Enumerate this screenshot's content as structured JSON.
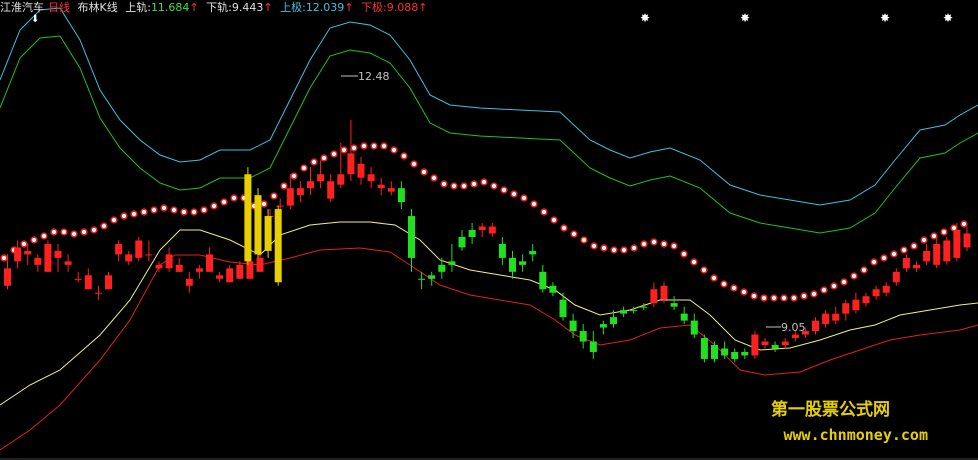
{
  "header": {
    "stock_name": "江淮汽车",
    "period": "日线",
    "indicator": "布林K线",
    "upper_label": "上轨:",
    "upper_value": "11.684",
    "lower_label": "下轨:",
    "lower_value": "9.443",
    "top_label": "上极:",
    "top_value": "12.039",
    "bottom_label": "下极:",
    "bottom_value": "9.088",
    "arrow": "↑"
  },
  "annotations": {
    "high_label": "12.48",
    "low_label": "9.05"
  },
  "watermark": {
    "line1": "第一股票公式网",
    "line2": "www.chnmoney.com"
  },
  "colors": {
    "up": "#ff2020",
    "down": "#20e020",
    "yellow": "#e8d000",
    "cyan": "#40c0e0",
    "green_band": "#20c020",
    "light_yellow": "#f0f080",
    "red_band": "#e02020"
  },
  "chart_data": {
    "type": "candlestick",
    "title": "布林K线",
    "ylim": [
      7.6,
      14.2
    ],
    "candles": [
      [
        0,
        10.35,
        10.55,
        10.05,
        10.1,
        "r"
      ],
      [
        1,
        10.45,
        10.75,
        10.35,
        10.65,
        "r"
      ],
      [
        2,
        10.55,
        10.7,
        10.4,
        10.6,
        "r"
      ],
      [
        3,
        10.4,
        10.55,
        10.3,
        10.5,
        "r"
      ],
      [
        4,
        10.7,
        10.75,
        10.3,
        10.3,
        "r"
      ],
      [
        5,
        10.6,
        10.7,
        10.3,
        10.5,
        "r"
      ],
      [
        6,
        10.45,
        10.55,
        10.3,
        10.4,
        "r"
      ],
      [
        7,
        10.2,
        10.3,
        10.15,
        10.2,
        "r"
      ],
      [
        8,
        10.25,
        10.35,
        10.05,
        10.05,
        "r"
      ],
      [
        9,
        10.0,
        10.1,
        9.9,
        10.0,
        "r"
      ],
      [
        10,
        10.25,
        10.3,
        10.05,
        10.05,
        "r"
      ],
      [
        11,
        10.55,
        10.75,
        10.45,
        10.7,
        "r"
      ],
      [
        12,
        10.45,
        10.6,
        10.4,
        10.55,
        "r"
      ],
      [
        13,
        10.75,
        10.8,
        10.45,
        10.5,
        "r"
      ],
      [
        14,
        10.55,
        10.75,
        10.45,
        10.55,
        "r"
      ],
      [
        15,
        10.35,
        10.45,
        10.3,
        10.4,
        "r"
      ],
      [
        16,
        10.55,
        10.65,
        10.3,
        10.35,
        "r"
      ],
      [
        17,
        10.4,
        10.5,
        10.3,
        10.3,
        "r"
      ],
      [
        18,
        10.2,
        10.3,
        10.0,
        10.1,
        "r"
      ],
      [
        19,
        10.35,
        10.4,
        10.2,
        10.3,
        "r"
      ],
      [
        20,
        10.55,
        10.65,
        10.3,
        10.3,
        "r"
      ],
      [
        21,
        10.25,
        10.3,
        10.15,
        10.2,
        "r"
      ],
      [
        22,
        10.35,
        10.4,
        10.15,
        10.15,
        "r"
      ],
      [
        23,
        10.4,
        10.45,
        10.2,
        10.2,
        "r"
      ],
      [
        24,
        10.45,
        10.5,
        10.2,
        10.2,
        "r"
      ],
      [
        25,
        10.5,
        10.6,
        10.3,
        10.3,
        "r"
      ],
      [
        26,
        11.1,
        11.2,
        10.9,
        11.1,
        "r"
      ],
      [
        27,
        11.25,
        11.35,
        11.1,
        11.25,
        "r"
      ],
      [
        28,
        11.5,
        11.7,
        11.2,
        11.25,
        "r"
      ],
      [
        29,
        11.5,
        11.6,
        11.3,
        11.4,
        "r"
      ],
      [
        30,
        11.6,
        11.8,
        11.4,
        11.5,
        "r"
      ],
      [
        31,
        11.7,
        11.9,
        11.5,
        11.6,
        "r"
      ],
      [
        32,
        11.6,
        11.7,
        11.3,
        11.35,
        "r"
      ],
      [
        33,
        11.7,
        12.15,
        11.5,
        11.55,
        "r"
      ],
      [
        34,
        12.0,
        12.48,
        11.6,
        11.7,
        "r"
      ],
      [
        35,
        11.85,
        11.95,
        11.55,
        11.65,
        "r"
      ],
      [
        36,
        11.7,
        11.8,
        11.5,
        11.6,
        "r"
      ],
      [
        37,
        11.55,
        11.65,
        11.4,
        11.5,
        "r"
      ],
      [
        38,
        11.5,
        11.6,
        11.4,
        11.45,
        "r"
      ],
      [
        39,
        11.5,
        11.6,
        11.2,
        11.3,
        "g"
      ],
      [
        40,
        11.1,
        11.2,
        10.3,
        10.5,
        "g"
      ],
      [
        41,
        10.2,
        10.3,
        10.05,
        10.2,
        "g"
      ],
      [
        42,
        10.25,
        10.3,
        10.1,
        10.2,
        "g"
      ],
      [
        43,
        10.4,
        10.5,
        10.2,
        10.3,
        "g"
      ],
      [
        44,
        10.45,
        10.7,
        10.3,
        10.4,
        "g"
      ],
      [
        45,
        10.8,
        10.9,
        10.6,
        10.65,
        "g"
      ],
      [
        46,
        10.9,
        11.0,
        10.7,
        10.8,
        "g"
      ],
      [
        47,
        10.95,
        11.0,
        10.8,
        10.9,
        "r"
      ],
      [
        48,
        10.95,
        11.0,
        10.8,
        10.85,
        "r"
      ],
      [
        49,
        10.7,
        10.8,
        10.4,
        10.5,
        "g"
      ],
      [
        50,
        10.5,
        10.6,
        10.2,
        10.3,
        "g"
      ],
      [
        51,
        10.45,
        10.55,
        10.3,
        10.4,
        "g"
      ],
      [
        52,
        10.6,
        10.7,
        10.45,
        10.55,
        "g"
      ],
      [
        53,
        10.3,
        10.4,
        10.0,
        10.05,
        "g"
      ],
      [
        54,
        10.1,
        10.15,
        9.95,
        10.0,
        "g"
      ],
      [
        55,
        9.9,
        10.0,
        9.6,
        9.65,
        "g"
      ],
      [
        56,
        9.6,
        9.7,
        9.35,
        9.45,
        "g"
      ],
      [
        57,
        9.45,
        9.55,
        9.2,
        9.3,
        "g"
      ],
      [
        58,
        9.3,
        9.45,
        9.05,
        9.15,
        "g"
      ],
      [
        59,
        9.55,
        9.6,
        9.4,
        9.5,
        "g"
      ],
      [
        60,
        9.65,
        9.75,
        9.5,
        9.55,
        "g"
      ],
      [
        61,
        9.75,
        9.8,
        9.65,
        9.7,
        "g"
      ],
      [
        62,
        9.75,
        9.8,
        9.7,
        9.75,
        "g"
      ],
      [
        63,
        9.8,
        9.85,
        9.75,
        9.8,
        "g"
      ],
      [
        64,
        10.05,
        10.15,
        9.8,
        9.85,
        "r"
      ],
      [
        65,
        10.1,
        10.15,
        9.85,
        9.9,
        "r"
      ],
      [
        66,
        9.85,
        9.95,
        9.75,
        9.8,
        "g"
      ],
      [
        67,
        9.7,
        9.8,
        9.55,
        9.6,
        "g"
      ],
      [
        68,
        9.6,
        9.7,
        9.35,
        9.4,
        "g"
      ],
      [
        69,
        9.35,
        9.4,
        9.0,
        9.05,
        "g"
      ],
      [
        70,
        9.25,
        9.3,
        9.0,
        9.05,
        "g"
      ],
      [
        71,
        9.2,
        9.3,
        9.05,
        9.1,
        "g"
      ],
      [
        72,
        9.15,
        9.2,
        9.0,
        9.05,
        "g"
      ],
      [
        73,
        9.15,
        9.2,
        9.05,
        9.1,
        "g"
      ],
      [
        74,
        9.4,
        9.45,
        9.05,
        9.1,
        "r"
      ],
      [
        75,
        9.3,
        9.35,
        9.2,
        9.25,
        "r"
      ],
      [
        76,
        9.25,
        9.3,
        9.15,
        9.2,
        "g"
      ],
      [
        77,
        9.3,
        9.35,
        9.2,
        9.25,
        "r"
      ],
      [
        78,
        9.4,
        9.45,
        9.3,
        9.35,
        "r"
      ],
      [
        79,
        9.45,
        9.5,
        9.35,
        9.4,
        "r"
      ],
      [
        80,
        9.6,
        9.65,
        9.4,
        9.45,
        "r"
      ],
      [
        81,
        9.7,
        9.75,
        9.5,
        9.55,
        "r"
      ],
      [
        82,
        9.7,
        9.8,
        9.55,
        9.6,
        "r"
      ],
      [
        83,
        9.85,
        9.9,
        9.6,
        9.7,
        "r"
      ],
      [
        84,
        9.9,
        10.0,
        9.7,
        9.75,
        "r"
      ],
      [
        85,
        9.95,
        10.0,
        9.8,
        9.85,
        "r"
      ],
      [
        86,
        10.05,
        10.1,
        9.9,
        9.95,
        "r"
      ],
      [
        87,
        10.1,
        10.15,
        9.95,
        10.0,
        "r"
      ],
      [
        88,
        10.3,
        10.35,
        10.1,
        10.15,
        "r"
      ],
      [
        89,
        10.5,
        10.55,
        10.3,
        10.35,
        "r"
      ],
      [
        90,
        10.4,
        10.45,
        10.3,
        10.35,
        "r"
      ],
      [
        91,
        10.6,
        10.7,
        10.4,
        10.45,
        "r"
      ],
      [
        92,
        10.7,
        10.8,
        10.35,
        10.4,
        "r"
      ],
      [
        93,
        10.75,
        10.8,
        10.4,
        10.45,
        "r"
      ],
      [
        94,
        10.9,
        11.0,
        10.45,
        10.5,
        "r"
      ],
      [
        95,
        10.85,
        10.95,
        10.6,
        10.65,
        "r"
      ]
    ],
    "yellow_candles": [
      [
        24,
        11.7,
        11.8,
        10.4,
        10.45
      ],
      [
        25,
        11.4,
        11.5,
        10.5,
        10.55
      ],
      [
        26,
        11.1,
        11.2,
        10.5,
        10.6
      ],
      [
        27,
        11.2,
        11.25,
        10.1,
        10.15
      ]
    ]
  }
}
